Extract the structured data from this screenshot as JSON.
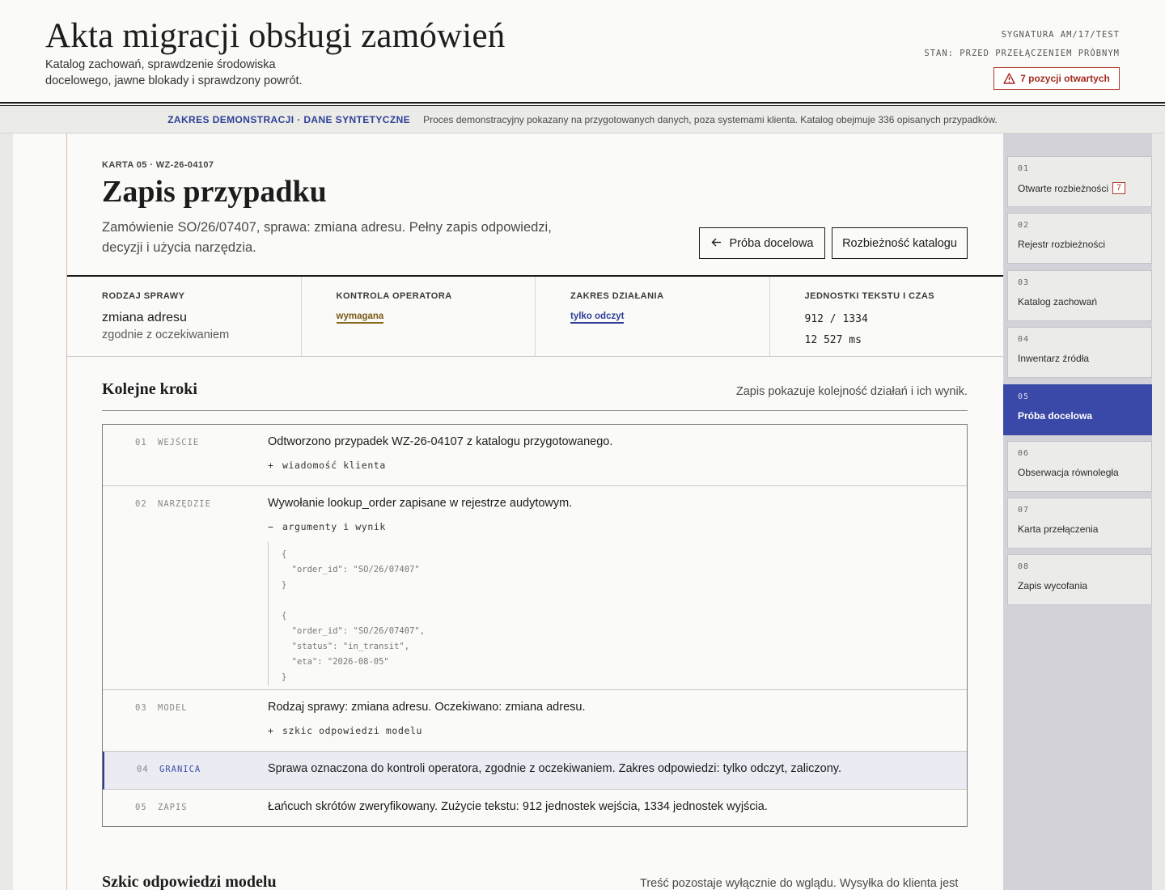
{
  "header": {
    "title": "Akta migracji obsługi zamówień",
    "subtitle": "Katalog zachowań, sprawdzenie środowiska docelowego, jawne blokady i sprawdzony powrót.",
    "signature": "SYGNATURA AM/17/TEST",
    "state": "STAN: PRZED PRZEŁĄCZENIEM PRÓBNYM",
    "open_items": "7 pozycji otwartych"
  },
  "banner": {
    "tag": "ZAKRES DEMONSTRACJI · DANE SYNTETYCZNE",
    "text": "Proces demonstracyjny pokazany na przygotowanych danych, poza systemami klienta. Katalog obejmuje 336 opisanych przypadków."
  },
  "card": {
    "label": "KARTA 05 · WZ-26-04107",
    "title": "Zapis przypadku",
    "description": "Zamówienie SO/26/07407, sprawa: zmiana adresu. Pełny zapis odpowiedzi, decyzji i użycia narzędzia.",
    "back_button": "Próba docelowa",
    "diff_button": "Rozbieżność katalogu"
  },
  "meta": {
    "case_type": {
      "head": "RODZAJ SPRAWY",
      "value": "zmiana adresu",
      "sub": "zgodnie z oczekiwaniem"
    },
    "operator": {
      "head": "KONTROLA OPERATORA",
      "value": "wymagana"
    },
    "scope": {
      "head": "ZAKRES DZIAŁANIA",
      "value": "tylko odczyt"
    },
    "units": {
      "head": "JEDNOSTKI TEKSTU I CZAS",
      "tokens": "912 / 1334",
      "time": "12 527 ms"
    }
  },
  "steps_section": {
    "title": "Kolejne kroki",
    "note": "Zapis pokazuje kolejność działań i ich wynik.",
    "steps": [
      {
        "num": "01",
        "kind": "WEJŚCIE",
        "text": "Odtworzono przypadek WZ-26-04107 z katalogu przygotowanego.",
        "toggle_sign": "+",
        "toggle": "wiadomość klienta"
      },
      {
        "num": "02",
        "kind": "NARZĘDZIE",
        "text": "Wywołanie lookup_order zapisane w rejestrze audytowym.",
        "toggle_sign": "−",
        "toggle": "argumenty i wynik",
        "code": {
          "args": [
            "{",
            "  \"order_id\": \"SO/26/07407\"",
            "}"
          ],
          "result": [
            "{",
            "  \"order_id\": \"SO/26/07407\",",
            "  \"status\": \"in_transit\",",
            "  \"eta\": \"2026-08-05\"",
            "}"
          ]
        }
      },
      {
        "num": "03",
        "kind": "MODEL",
        "text": "Rodzaj sprawy: zmiana adresu. Oczekiwano: zmiana adresu.",
        "toggle_sign": "+",
        "toggle": "szkic odpowiedzi modelu"
      },
      {
        "num": "04",
        "kind": "GRANICA",
        "text": "Sprawa oznaczona do kontroli operatora, zgodnie z oczekiwaniem. Zakres odpowiedzi: tylko odczyt, zaliczony."
      },
      {
        "num": "05",
        "kind": "ZAPIS",
        "text": "Łańcuch skrótów zweryfikowany. Zużycie tekstu: 912 jednostek wejścia, 1334 jednostek wyjścia."
      }
    ]
  },
  "draft_section": {
    "title": "Szkic odpowiedzi modelu",
    "note": "Treść pozostaje wyłącznie do wglądu. Wysyłka do klienta jest"
  },
  "nav": {
    "items": [
      {
        "num": "01",
        "label": "Otwarte rozbieżności",
        "count": "7"
      },
      {
        "num": "02",
        "label": "Rejestr rozbieżności"
      },
      {
        "num": "03",
        "label": "Katalog zachowań"
      },
      {
        "num": "04",
        "label": "Inwentarz źródła"
      },
      {
        "num": "05",
        "label": "Próba docelowa",
        "active": true
      },
      {
        "num": "06",
        "label": "Obserwacja równoległa"
      },
      {
        "num": "07",
        "label": "Karta przełączenia"
      },
      {
        "num": "08",
        "label": "Zapis wycofania"
      }
    ]
  },
  "colors": {
    "accent": "#3a49a7",
    "warning": "#a32c1f",
    "operator": "#7b5a17"
  },
  "icons": {
    "warning": "warning-triangle-icon",
    "back": "arrow-left-icon"
  }
}
